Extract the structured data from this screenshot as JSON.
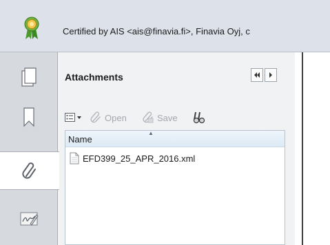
{
  "certification": {
    "icon": "certificate-ribbon-icon",
    "text": "Certified by AIS <ais@finavia.fi>, Finavia Oyj, c"
  },
  "nav": {
    "items": [
      {
        "icon": "pages-icon",
        "active": false
      },
      {
        "icon": "bookmarks-icon",
        "active": false
      },
      {
        "icon": "attachments-paperclip-icon",
        "active": true
      },
      {
        "icon": "signatures-icon",
        "active": false
      }
    ]
  },
  "attachments_panel": {
    "title": "Attachments",
    "collapse_icon": "double-left-arrow-icon",
    "expand_icon": "right-arrow-icon",
    "toolbar": {
      "options_icon": "options-menu-icon",
      "open_label": "Open",
      "save_label": "Save",
      "search_icon": "binoculars-icon"
    },
    "columns": [
      "Name"
    ],
    "files": [
      {
        "name": "EFD399_25_APR_2016.xml",
        "icon": "xml-file-icon"
      }
    ]
  },
  "colors": {
    "banner_bg": "#dde2ea",
    "panel_bg": "#f1f2f4",
    "nav_bg": "#d6d9de",
    "header_bg": "#ddeaf5",
    "disabled_text": "#a3a7ad"
  }
}
